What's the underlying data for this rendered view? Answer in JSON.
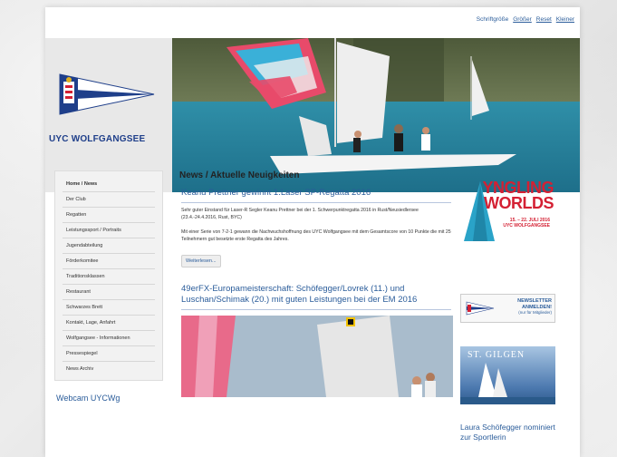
{
  "toolbar": {
    "font_size_label": "Schriftgröße",
    "bigger": "Größer",
    "reset": "Reset",
    "smaller": "Kleiner"
  },
  "logo": {
    "name": "UYC WOLFGANGSEE"
  },
  "nav": {
    "items": [
      {
        "label": "Home / News",
        "active": true
      },
      {
        "label": "Der Club"
      },
      {
        "label": "Regatten"
      },
      {
        "label": "Leistungssport / Portraits"
      },
      {
        "label": "Jugendabteilung"
      },
      {
        "label": "Förderkomitee"
      },
      {
        "label": "Traditionsklassen"
      },
      {
        "label": "Restaurant"
      },
      {
        "label": "Schwarzes Brett"
      },
      {
        "label": "Kontakt, Lage, Anfahrt"
      },
      {
        "label": "Wolfgangsee - Informationen"
      },
      {
        "label": "Pressespiegel"
      },
      {
        "label": "News Archiv"
      }
    ]
  },
  "webcam": {
    "title": "Webcam UYCWg"
  },
  "main": {
    "heading": "News / Aktuelle Neuigkeiten",
    "article1": {
      "title": "Keanu Prettner gewinnt 1.Laser SP-Regatta 2016",
      "p1": "Sehr guter Einstand für Laser-R Segler Keanu Prettner bei der 1. Schwerpunktregatta 2016 in Rust/Neusiedlersee (23.4.-24.4.2016, Rust, BYC)",
      "p2": "Mit einer Serie von 7-2-1 gewann die Nachwuchshoffnung des UYC Wolfgangsee mit dem Gesamtscore von 10 Punkte die mit 25 Teilnehmern gut besetzte erste Regatta des Jahres.",
      "more": "Weiterlesen..."
    },
    "article2": {
      "title": "49erFX-Europameisterschaft: Schöfegger/Lovrek (11.) und Luschan/Schimak (20.) mit guten Leistungen bei der EM 2016"
    }
  },
  "right": {
    "yngling_title_1": "YNGLING",
    "yngling_title_2": "WORLDS",
    "yngling_dates": "15. – 22. JULI 2016",
    "yngling_org": "UYC WOLFGANGSEE",
    "newsletter_1": "NEWSLETTER",
    "newsletter_2": "ANMELDEN!",
    "newsletter_note": "(nur für Mitglieder)",
    "stgilgen": "ST. GILGEN",
    "laura": "Laura Schöfegger nominiert zur Sportlerin"
  },
  "colors": {
    "link_blue": "#2a5c9a",
    "brand_red": "#d42033",
    "logo_blue": "#1f3f8a"
  }
}
